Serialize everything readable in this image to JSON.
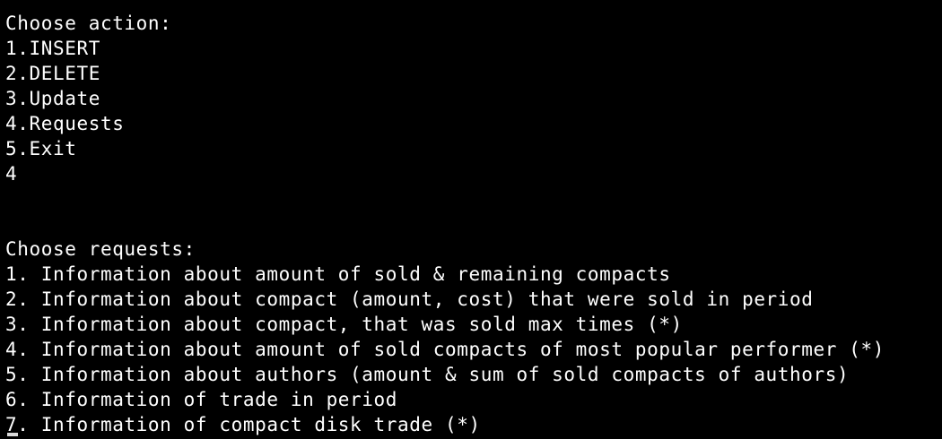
{
  "terminal": {
    "lines": [
      "Choose action:",
      "1.INSERT",
      "2.DELETE",
      "3.Update",
      "4.Requests",
      "5.Exit",
      "4",
      "",
      "",
      "Choose requests:",
      "1. Information about amount of sold & remaining compacts",
      "2. Information about compact (amount, cost) that were sold in period",
      "3. Information about compact, that was sold max times (*)",
      "4. Information about amount of sold compacts of most popular performer (*)",
      "5. Information about authors (amount & sum of sold compacts of authors)",
      "6. Information of trade in period",
      "7. Information of compact disk trade (*)"
    ]
  }
}
